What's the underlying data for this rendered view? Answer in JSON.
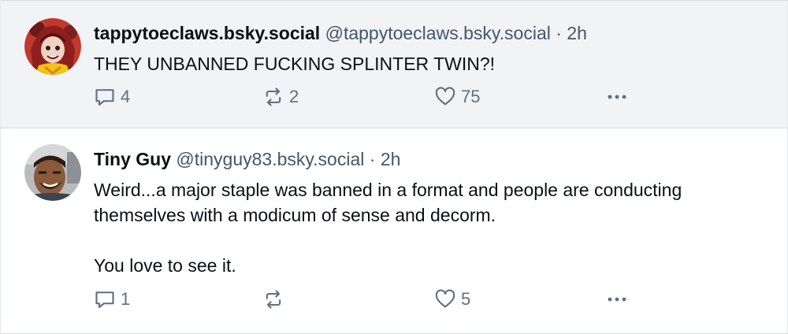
{
  "posts": [
    {
      "display_name": "tappytoeclaws.bsky.social",
      "handle": "@tappytoeclaws.bsky.social",
      "separator": "·",
      "time": "2h",
      "text": [
        "THEY UNBANNED FUCKING SPLINTER TWIN?!"
      ],
      "reply_count": "4",
      "repost_count": "2",
      "like_count": "75",
      "avatar_icon": "anime-character-avatar"
    },
    {
      "display_name": "Tiny Guy",
      "handle": "@tinyguy83.bsky.social",
      "separator": "·",
      "time": "2h",
      "text": [
        "Weird...a major staple was banned in a format and people are conducting themselves with a modicum of sense and decorm.",
        "You love to see it."
      ],
      "reply_count": "1",
      "repost_count": "",
      "like_count": "5",
      "avatar_icon": "smiling-man-photo-avatar"
    }
  ],
  "colors": {
    "name": "#0b0f14",
    "meta": "#42576c",
    "icon": "#5b7083",
    "highlight_bg": "#f1f3f5",
    "border": "#d4dbe2"
  },
  "icons": {
    "reply": "reply-bubble-icon",
    "repost": "repost-arrows-icon",
    "like": "heart-icon",
    "more": "more-dots-icon"
  }
}
